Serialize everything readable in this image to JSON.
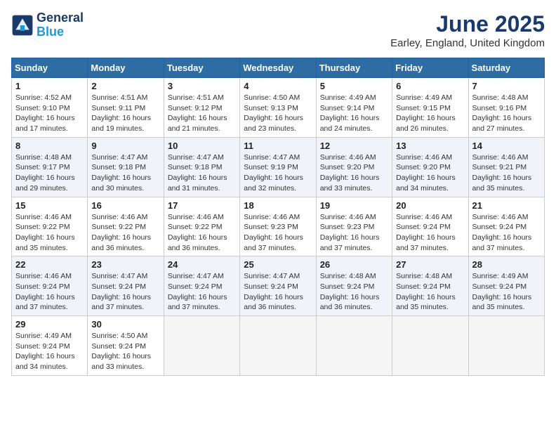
{
  "logo": {
    "line1": "General",
    "line2": "Blue"
  },
  "title": "June 2025",
  "subtitle": "Earley, England, United Kingdom",
  "days_of_week": [
    "Sunday",
    "Monday",
    "Tuesday",
    "Wednesday",
    "Thursday",
    "Friday",
    "Saturday"
  ],
  "weeks": [
    [
      {
        "day": 1,
        "rise": "4:52 AM",
        "set": "9:10 PM",
        "daylight": "16 hours and 17 minutes."
      },
      {
        "day": 2,
        "rise": "4:51 AM",
        "set": "9:11 PM",
        "daylight": "16 hours and 19 minutes."
      },
      {
        "day": 3,
        "rise": "4:51 AM",
        "set": "9:12 PM",
        "daylight": "16 hours and 21 minutes."
      },
      {
        "day": 4,
        "rise": "4:50 AM",
        "set": "9:13 PM",
        "daylight": "16 hours and 23 minutes."
      },
      {
        "day": 5,
        "rise": "4:49 AM",
        "set": "9:14 PM",
        "daylight": "16 hours and 24 minutes."
      },
      {
        "day": 6,
        "rise": "4:49 AM",
        "set": "9:15 PM",
        "daylight": "16 hours and 26 minutes."
      },
      {
        "day": 7,
        "rise": "4:48 AM",
        "set": "9:16 PM",
        "daylight": "16 hours and 27 minutes."
      }
    ],
    [
      {
        "day": 8,
        "rise": "4:48 AM",
        "set": "9:17 PM",
        "daylight": "16 hours and 29 minutes."
      },
      {
        "day": 9,
        "rise": "4:47 AM",
        "set": "9:18 PM",
        "daylight": "16 hours and 30 minutes."
      },
      {
        "day": 10,
        "rise": "4:47 AM",
        "set": "9:18 PM",
        "daylight": "16 hours and 31 minutes."
      },
      {
        "day": 11,
        "rise": "4:47 AM",
        "set": "9:19 PM",
        "daylight": "16 hours and 32 minutes."
      },
      {
        "day": 12,
        "rise": "4:46 AM",
        "set": "9:20 PM",
        "daylight": "16 hours and 33 minutes."
      },
      {
        "day": 13,
        "rise": "4:46 AM",
        "set": "9:20 PM",
        "daylight": "16 hours and 34 minutes."
      },
      {
        "day": 14,
        "rise": "4:46 AM",
        "set": "9:21 PM",
        "daylight": "16 hours and 35 minutes."
      }
    ],
    [
      {
        "day": 15,
        "rise": "4:46 AM",
        "set": "9:22 PM",
        "daylight": "16 hours and 35 minutes."
      },
      {
        "day": 16,
        "rise": "4:46 AM",
        "set": "9:22 PM",
        "daylight": "16 hours and 36 minutes."
      },
      {
        "day": 17,
        "rise": "4:46 AM",
        "set": "9:22 PM",
        "daylight": "16 hours and 36 minutes."
      },
      {
        "day": 18,
        "rise": "4:46 AM",
        "set": "9:23 PM",
        "daylight": "16 hours and 37 minutes."
      },
      {
        "day": 19,
        "rise": "4:46 AM",
        "set": "9:23 PM",
        "daylight": "16 hours and 37 minutes."
      },
      {
        "day": 20,
        "rise": "4:46 AM",
        "set": "9:24 PM",
        "daylight": "16 hours and 37 minutes."
      },
      {
        "day": 21,
        "rise": "4:46 AM",
        "set": "9:24 PM",
        "daylight": "16 hours and 37 minutes."
      }
    ],
    [
      {
        "day": 22,
        "rise": "4:46 AM",
        "set": "9:24 PM",
        "daylight": "16 hours and 37 minutes."
      },
      {
        "day": 23,
        "rise": "4:47 AM",
        "set": "9:24 PM",
        "daylight": "16 hours and 37 minutes."
      },
      {
        "day": 24,
        "rise": "4:47 AM",
        "set": "9:24 PM",
        "daylight": "16 hours and 37 minutes."
      },
      {
        "day": 25,
        "rise": "4:47 AM",
        "set": "9:24 PM",
        "daylight": "16 hours and 36 minutes."
      },
      {
        "day": 26,
        "rise": "4:48 AM",
        "set": "9:24 PM",
        "daylight": "16 hours and 36 minutes."
      },
      {
        "day": 27,
        "rise": "4:48 AM",
        "set": "9:24 PM",
        "daylight": "16 hours and 35 minutes."
      },
      {
        "day": 28,
        "rise": "4:49 AM",
        "set": "9:24 PM",
        "daylight": "16 hours and 35 minutes."
      }
    ],
    [
      {
        "day": 29,
        "rise": "4:49 AM",
        "set": "9:24 PM",
        "daylight": "16 hours and 34 minutes."
      },
      {
        "day": 30,
        "rise": "4:50 AM",
        "set": "9:24 PM",
        "daylight": "16 hours and 33 minutes."
      },
      null,
      null,
      null,
      null,
      null
    ]
  ]
}
